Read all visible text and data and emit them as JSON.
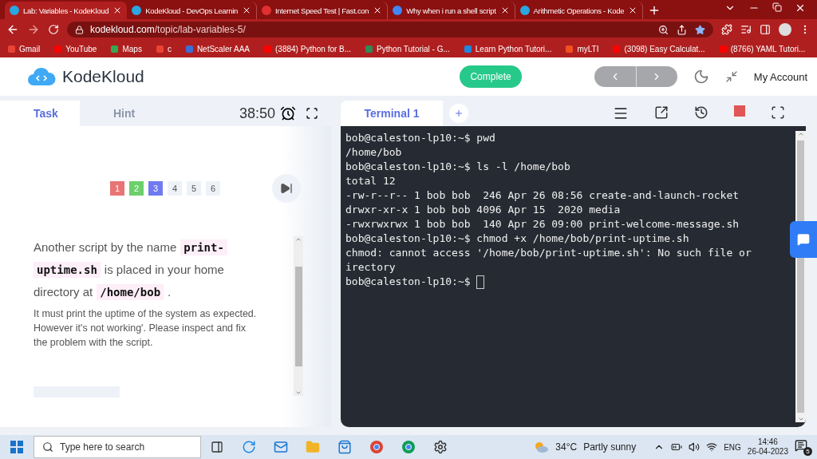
{
  "browser": {
    "tabs": [
      {
        "title": "Lab: Variables - KodeKloud",
        "selected": true,
        "color": "#2aa6e0"
      },
      {
        "title": "KodeKloud - DevOps Learnin",
        "selected": false,
        "color": "#2aa6e0"
      },
      {
        "title": "Internet Speed Test | Fast.con",
        "selected": false,
        "color": "#e03030"
      },
      {
        "title": "Why when i run a shell script",
        "selected": false,
        "color": "#4285f4"
      },
      {
        "title": "Arithmetic Operations - Kode",
        "selected": false,
        "color": "#2aa6e0"
      }
    ],
    "address": {
      "domain": "kodekloud.com",
      "path": "/topic/lab-variables-5/"
    },
    "bookmarks": [
      {
        "label": "Gmail",
        "color": "#ea4335"
      },
      {
        "label": "YouTube",
        "color": "#ff0000"
      },
      {
        "label": "Maps",
        "color": "#34a853"
      },
      {
        "label": "c",
        "color": "#ea4335"
      },
      {
        "label": "NetScaler AAA",
        "color": "#3b6fd6"
      },
      {
        "label": "(3884) Python for B...",
        "color": "#ff0000"
      },
      {
        "label": "Python Tutorial - G...",
        "color": "#2e8b57"
      },
      {
        "label": "Learn Python Tutori...",
        "color": "#1e88e5"
      },
      {
        "label": "myLTI",
        "color": "#f25022"
      },
      {
        "label": "(3098) Easy Calculat...",
        "color": "#ff0000"
      },
      {
        "label": "(8766) YAML Tutori...",
        "color": "#ff0000"
      }
    ]
  },
  "header": {
    "logo": "KodeKloud",
    "complete": "Complete",
    "account": "My Account"
  },
  "task_panel": {
    "tabs": [
      {
        "label": "Task",
        "selected": true
      },
      {
        "label": "Hint",
        "selected": false
      }
    ],
    "timer": "38:50",
    "steps": [
      {
        "label": "1",
        "color": "#e87474"
      },
      {
        "label": "2",
        "color": "#6ccf6c"
      },
      {
        "label": "3",
        "color": "#6f7af0"
      },
      {
        "label": "4",
        "color": "#eef2f8"
      },
      {
        "label": "5",
        "color": "#eef2f8"
      },
      {
        "label": "6",
        "color": "#eef2f8"
      }
    ],
    "question": [
      {
        "kind": "text",
        "text": "Another script by the name"
      },
      {
        "kind": "code",
        "text": "print-"
      },
      {
        "kind": "code",
        "text": "uptime.sh"
      },
      {
        "kind": "text",
        "text": "is placed in your home directory at"
      },
      {
        "kind": "code",
        "text": "/home/bob"
      },
      {
        "kind": "text",
        "text": "."
      }
    ],
    "note": "It must print the uptime of the system as expected. However it's not working'. Please inspect and fix the problem with the script."
  },
  "terminal": {
    "tab": "Terminal 1",
    "cursor": true,
    "lines": [
      "bob@caleston-lp10:~$ pwd",
      "/home/bob",
      "bob@caleston-lp10:~$ ls -l /home/bob",
      "total 12",
      "-rw-r--r-- 1 bob bob  246 Apr 26 08:56 create-and-launch-rocket",
      "drwxr-xr-x 1 bob bob 4096 Apr 15  2020 media",
      "-rwxrwxrwx 1 bob bob  140 Apr 26 09:00 print-welcome-message.sh",
      "bob@caleston-lp10:~$ chmod +x /home/bob/print-uptime.sh",
      "chmod: cannot access '/home/bob/print-uptime.sh': No such file or",
      "irectory",
      "bob@caleston-lp10:~$ "
    ]
  },
  "taskbar": {
    "search_placeholder": "Type here to search",
    "weather": "34°C",
    "weather_text": "Partly sunny",
    "language": "ENG",
    "time": "14:46",
    "date": "26-04-2023",
    "notifications": "5"
  }
}
